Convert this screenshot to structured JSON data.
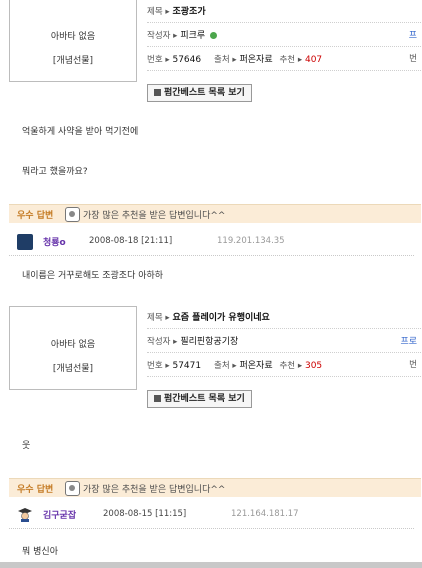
{
  "post1": {
    "avatar_status": "아바타 없음",
    "avatar_tag": "[개념선물]",
    "title_label": "제목 ▸",
    "title": "조광조가",
    "author_label": "작성자 ▸",
    "author": "피크루",
    "author_link": "프",
    "number_label": "번호 ▸",
    "number": "57646",
    "source_label": "출처 ▸",
    "source": "퍼온자료",
    "recommend_label": "추천 ▸",
    "recommend": "407",
    "trailing": "번",
    "button": "펌간베스트 목록 보기",
    "body_lines": [
      "억울하게 사약을 받아 먹기전에",
      "뭐라고 했을까요?"
    ]
  },
  "answer1": {
    "title": "우수 답변",
    "desc": "가장 많은 추천을 받은 답변입니다^^",
    "user": "청룡o",
    "date": "2008-08-18 [21:11]",
    "ip": "119.201.134.35",
    "text": "내이름은 거꾸로해도 조광조다 아하하"
  },
  "post2": {
    "avatar_status": "아바타 없음",
    "avatar_tag": "[개념선물]",
    "title_label": "제목 ▸",
    "title": "요즘 플레이가 유행이네요",
    "author_label": "작성자 ▸",
    "author": "필리핀항공기장",
    "author_link": "프로",
    "number_label": "번호 ▸",
    "number": "57471",
    "source_label": "출처 ▸",
    "source": "퍼온자료",
    "recommend_label": "추천 ▸",
    "recommend": "305",
    "trailing": "번",
    "button": "펌간베스트 목록 보기",
    "body_lines": [
      "웃"
    ]
  },
  "answer2": {
    "title": "우수 답변",
    "desc": "가장 많은 추천을 받은 답변입니다^^",
    "user": "김구굳잡",
    "date": "2008-08-15 [11:15]",
    "ip": "121.164.181.17",
    "text": "뭐 병신아"
  }
}
